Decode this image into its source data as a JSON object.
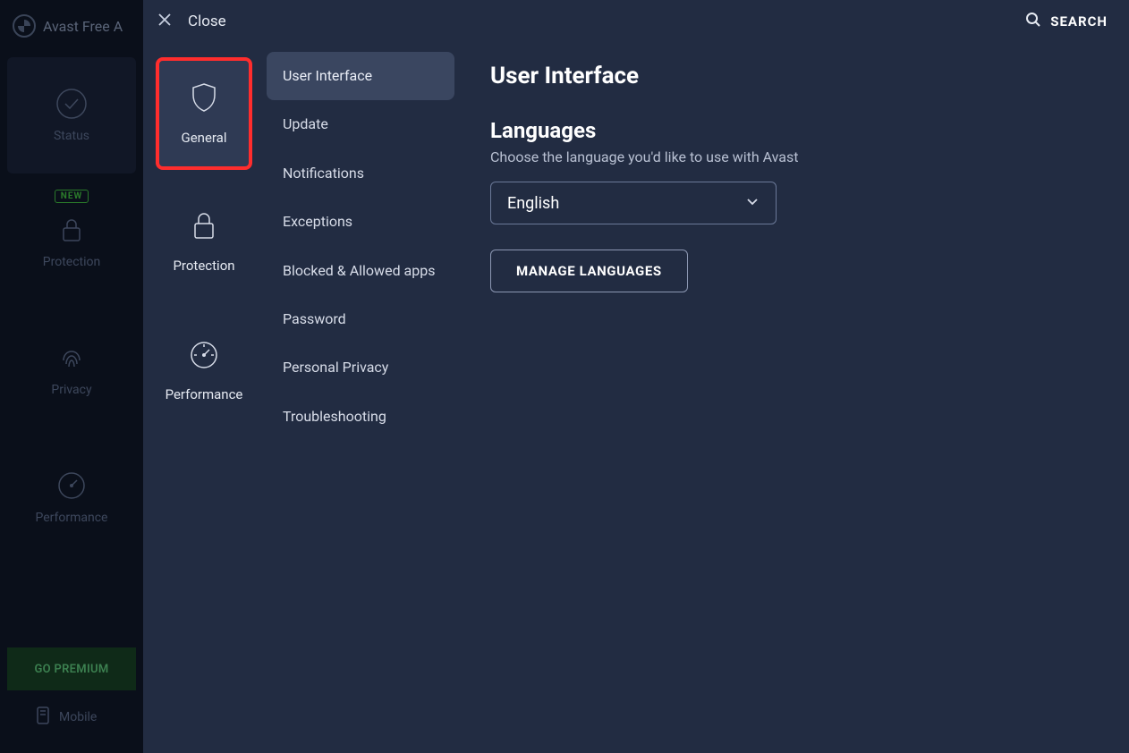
{
  "app": {
    "title_truncated": "Avast Free A"
  },
  "bg_nav": {
    "items": [
      {
        "label": "Status"
      },
      {
        "label": "Protection",
        "badge": "NEW"
      },
      {
        "label": "Privacy"
      },
      {
        "label": "Performance"
      }
    ],
    "premium_label": "GO PREMIUM",
    "mobile_label": "Mobile"
  },
  "panel": {
    "close_label": "Close",
    "search_label": "SEARCH"
  },
  "categories": [
    {
      "label": "General",
      "active": true
    },
    {
      "label": "Protection"
    },
    {
      "label": "Performance"
    }
  ],
  "sub_nav": [
    {
      "label": "User Interface",
      "active": true
    },
    {
      "label": "Update"
    },
    {
      "label": "Notifications"
    },
    {
      "label": "Exceptions"
    },
    {
      "label": "Blocked & Allowed apps"
    },
    {
      "label": "Password"
    },
    {
      "label": "Personal Privacy"
    },
    {
      "label": "Troubleshooting"
    }
  ],
  "content": {
    "heading": "User Interface",
    "languages_heading": "Languages",
    "languages_desc": "Choose the language you'd like to use with Avast",
    "language_selected": "English",
    "manage_btn": "MANAGE LANGUAGES"
  }
}
